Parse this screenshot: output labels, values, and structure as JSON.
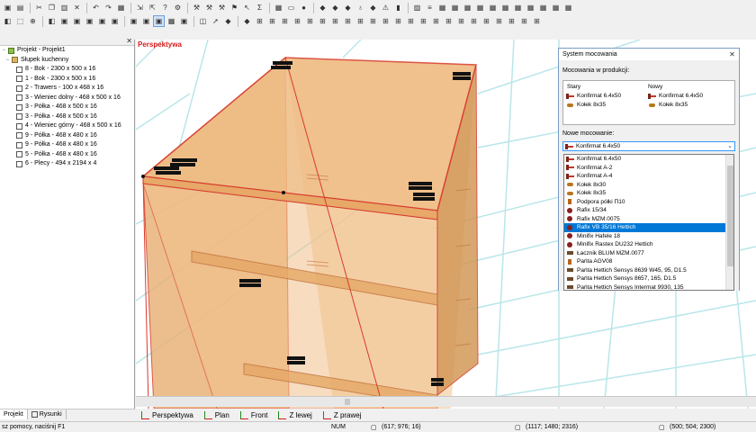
{
  "toolbar": {
    "row1_icons": [
      "folder-open-icon",
      "open-icon",
      "cut-icon",
      "copy-icon",
      "paste-icon",
      "delete-icon",
      "undo-icon",
      "redo-icon",
      "save-icon",
      "import-icon",
      "export-icon",
      "question-icon",
      "settings-icon",
      "tool-icon",
      "tool-icon",
      "tool-icon",
      "connection-icon",
      "cursor-icon",
      "sigma-icon",
      "calendar-icon",
      "panel-icon",
      "sphere-icon",
      "cube-icon",
      "cube-icon",
      "cube-icon",
      "vase-icon",
      "cube-icon",
      "warning-icon",
      "column-icon",
      "image-icon",
      "list-icon",
      "grid-icon",
      "grid-icon",
      "grid-icon",
      "grid-icon",
      "grid-icon",
      "grid-icon",
      "grid-icon",
      "grid-icon",
      "grid-icon",
      "grid-icon",
      "grid-icon"
    ],
    "row2_icons": [
      "view-icon",
      "select-icon",
      "zoom-icon",
      "view-icon",
      "box-icon",
      "box-icon",
      "box-icon",
      "box-icon",
      "box-icon",
      "box-icon",
      "box-icon",
      "box-icon",
      "grid-icon",
      "box-icon",
      "layers-icon",
      "arrow-icon",
      "cube-icon",
      "cube-icon",
      "tools-icon",
      "tools-icon",
      "tools-icon",
      "tools-icon",
      "tools-icon",
      "tools-icon",
      "tools-icon",
      "tools-icon",
      "tools-icon",
      "tools-icon",
      "tools-icon",
      "tools-icon",
      "tools-icon",
      "tools-icon",
      "tools-icon",
      "tools-icon",
      "tools-icon",
      "tools-icon",
      "tools-icon",
      "tools-icon",
      "tools-icon",
      "tools-icon",
      "tools-icon"
    ]
  },
  "tree": {
    "project": "Projekt - Projekt1",
    "cabinet": "Słupek kuchenny",
    "parts": [
      "8 - Bok - 2300 x 500 x 16",
      "1 - Bok - 2300 x 500 x 16",
      "2 - Trawers - 100 x 468 x 16",
      "3 - Wieniec dolny - 468 x 500 x 16",
      "3 - Półka - 468 x 500 x 16",
      "3 - Półka - 468 x 500 x 16",
      "4 - Wieniec górny - 468 x 500 x 16",
      "9 - Półka - 468 x 480 x 16",
      "9 - Półka - 468 x 480 x 16",
      "5 - Półka - 468 x 480 x 16",
      "6 - Plecy - 494 x 2194 x 4"
    ]
  },
  "panel_tabs": [
    "Projekt",
    "Rysunki"
  ],
  "viewport": {
    "label": "Perspektywa"
  },
  "view_tabs": [
    "Perspektywa",
    "Plan",
    "Front",
    "Z lewej",
    "Z prawej"
  ],
  "status": {
    "help": "sz pomocy, naciśnij F1",
    "num": "NUM",
    "coord1": "(617; 976; 16)",
    "coord2": "(1117; 1480; 2316)",
    "coord3": "(500; 504; 2300)"
  },
  "dialog": {
    "title": "System mocowania",
    "production_label": "Mocowania w produkcji:",
    "col_old": "Stary",
    "col_new": "Nowy",
    "production_rows": [
      {
        "old": "Konfirmat 6.4x50",
        "new": "Konfirmat 6.4x50",
        "icon": "screw"
      },
      {
        "old": "Kołek 8x35",
        "new": "Kołek 8x35",
        "icon": "dowel"
      }
    ],
    "new_label": "Nowe mocowanie:",
    "combo_value": "Konfirmat 6.4x50",
    "options": [
      {
        "label": "Konfirmat 6.4x50",
        "icon": "screw"
      },
      {
        "label": "Konfirmat A-2",
        "icon": "screw"
      },
      {
        "label": "Konfirmat A-4",
        "icon": "screw"
      },
      {
        "label": "Kołek 8x30",
        "icon": "dowel"
      },
      {
        "label": "Kołek 8x35",
        "icon": "dowel"
      },
      {
        "label": "Podpora półki Π10",
        "icon": "shelf"
      },
      {
        "label": "Rafix 15/34",
        "icon": "cam"
      },
      {
        "label": "Rafix MZM.0075",
        "icon": "cam"
      },
      {
        "label": "Rafix VB 35/16 Hettich",
        "icon": "cam"
      },
      {
        "label": "Minifix Hafele 18",
        "icon": "cam"
      },
      {
        "label": "Minifix Rastex DU232 Hettich",
        "icon": "cam"
      },
      {
        "label": "Łacznik BLUM MZM.0077",
        "icon": "hinge"
      },
      {
        "label": "Pańta AGV08",
        "icon": "shelf"
      },
      {
        "label": "Pańta Hettich Sensys 8639 W45, 95, D1.5",
        "icon": "hinge"
      },
      {
        "label": "Pańta Hettich Sensys 8657, 165, D1.5",
        "icon": "hinge"
      },
      {
        "label": "Pańta Hettich Sensys Intermat 9930, 135",
        "icon": "hinge"
      }
    ],
    "selected_index": 8
  },
  "colors": {
    "cabinet_fill": "#e9b37a",
    "cabinet_edge": "#d83b2c",
    "grid_line": "#b9e6ea",
    "selection": "#0078d7",
    "view_label": "#d81b1b"
  }
}
